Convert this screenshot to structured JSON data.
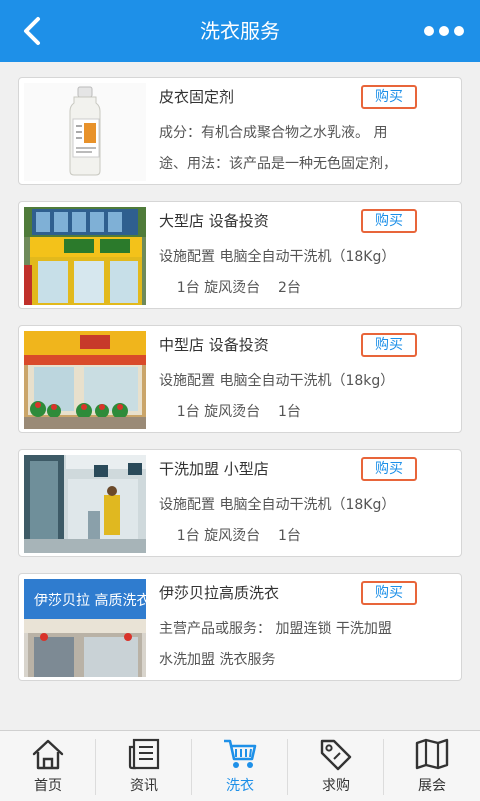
{
  "header": {
    "title": "洗衣服务",
    "back_icon": "chevron-left-icon",
    "more_icon": "more-dots-icon",
    "bg_color": "#1e90e8"
  },
  "products": [
    {
      "title": "皮衣固定剂",
      "buy_label": "购买",
      "lines": [
        "成分：有机合成聚合物之水乳液。 用",
        "途、用法：该产品是一种无色固定剂，"
      ],
      "image": "bottle-image"
    },
    {
      "title": "大型店  设备投资",
      "buy_label": "购买",
      "lines": [
        "设施配置 电脑全自动干洗机（18Kg）",
        "    1台 旋风烫台    2台"
      ],
      "image": "large-store-image"
    },
    {
      "title": "中型店  设备投资",
      "buy_label": "购买",
      "lines": [
        "设施配置 电脑全自动干洗机（18kg）",
        "    1台 旋风烫台    1台"
      ],
      "image": "medium-store-image"
    },
    {
      "title": "干洗加盟  小型店",
      "buy_label": "购买",
      "lines": [
        "设施配置 电脑全自动干洗机（18Kg）",
        "    1台 旋风烫台    1台"
      ],
      "image": "small-store-image"
    },
    {
      "title": "伊莎贝拉高质洗衣",
      "buy_label": "购买",
      "lines": [
        "主营产品或服务： 加盟连锁 干洗加盟",
        "水洗加盟 洗衣服务"
      ],
      "image": "storefront-sign-image",
      "sign_text": "伊莎贝拉 高质洗衣"
    }
  ],
  "tabbar": [
    {
      "label": "首页",
      "icon": "home-icon",
      "active": false
    },
    {
      "label": "资讯",
      "icon": "news-icon",
      "active": false
    },
    {
      "label": "洗衣",
      "icon": "cart-icon",
      "active": true
    },
    {
      "label": "求购",
      "icon": "tag-icon",
      "active": false
    },
    {
      "label": "展会",
      "icon": "map-icon",
      "active": false
    }
  ],
  "colors": {
    "accent": "#1e90e8",
    "buy_border": "#e8653a",
    "background": "#f0f0f0"
  }
}
